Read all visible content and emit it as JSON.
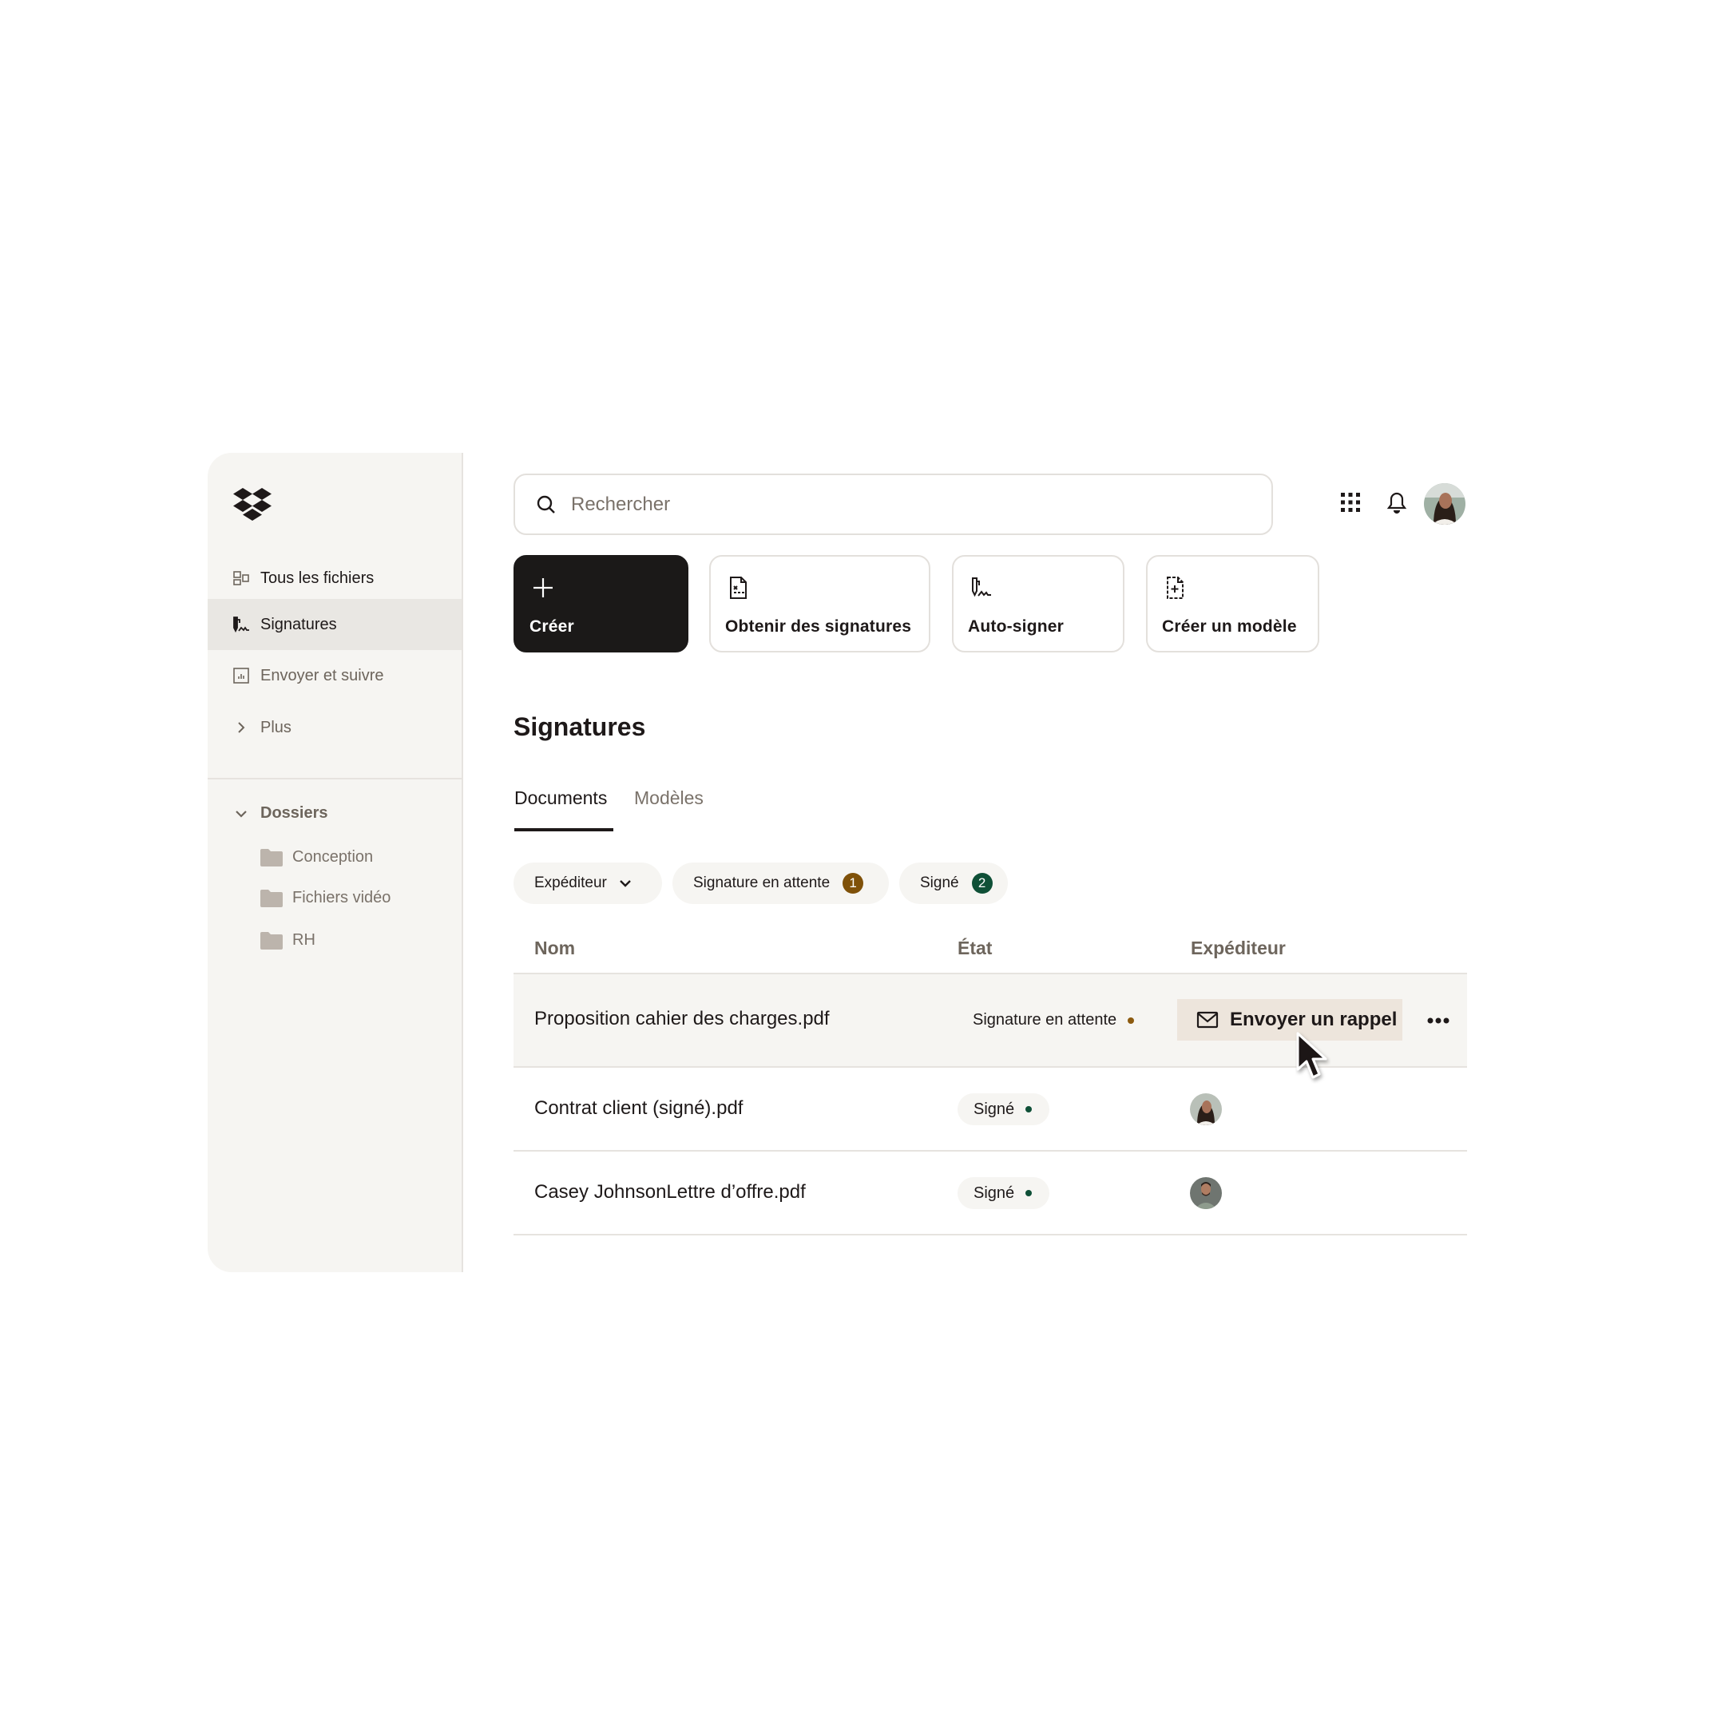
{
  "sidebar": {
    "logo": "dropbox-logo",
    "nav": [
      {
        "label": "Tous les fichiers",
        "icon": "all-files-icon",
        "state": "normal"
      },
      {
        "label": "Signatures",
        "icon": "signature-icon",
        "state": "active"
      },
      {
        "label": "Envoyer et suivre",
        "icon": "send-track-icon",
        "state": "muted"
      },
      {
        "label": "Plus",
        "icon": "chevron-right-icon",
        "state": "muted"
      }
    ],
    "folders_header": "Dossiers",
    "folders": [
      {
        "label": "Conception"
      },
      {
        "label": "Fichiers vidéo"
      },
      {
        "label": "RH"
      }
    ]
  },
  "search": {
    "placeholder": "Rechercher",
    "value": ""
  },
  "topbar": {
    "icons": [
      "apps-grid-icon",
      "bell-icon",
      "user-avatar"
    ]
  },
  "actions": [
    {
      "label": "Créer",
      "icon": "plus-icon",
      "style": "primary"
    },
    {
      "label": "Obtenir des signatures",
      "icon": "document-signature-icon",
      "style": "secondary"
    },
    {
      "label": "Auto-signer",
      "icon": "self-sign-icon",
      "style": "secondary"
    },
    {
      "label": "Créer un modèle",
      "icon": "template-add-icon",
      "style": "secondary"
    }
  ],
  "page": {
    "title": "Signatures",
    "tabs": [
      {
        "label": "Documents",
        "active": true
      },
      {
        "label": "Modèles",
        "active": false
      }
    ]
  },
  "filters": [
    {
      "label": "Expéditeur",
      "type": "dropdown"
    },
    {
      "label": "Signature en attente",
      "count": "1",
      "color": "#7f5109"
    },
    {
      "label": "Signé",
      "count": "2",
      "color": "#0f5037"
    }
  ],
  "table": {
    "columns": [
      "Nom",
      "État",
      "Expéditeur"
    ],
    "rows": [
      {
        "name": "Proposition cahier des charges.pdf",
        "status": "Signature en attente",
        "status_color": "#8c5a0f",
        "action_label": "Envoyer un rappel",
        "sender": null,
        "hovered": true
      },
      {
        "name": "Contrat client (signé).pdf",
        "status": "Signé",
        "status_color": "#0f5037",
        "sender": "woman-avatar"
      },
      {
        "name": "Casey JohnsonLettre d’offre.pdf",
        "status": "Signé",
        "status_color": "#0f5037",
        "sender": "man-avatar"
      }
    ]
  },
  "colors": {
    "sidebar_bg": "#f6f5f2",
    "active_nav_bg": "#e9e7e3",
    "primary_button": "#1b1918",
    "reminder_button_bg": "#ede5dc",
    "pending": "#8c5a0f",
    "signed": "#0f5037"
  }
}
